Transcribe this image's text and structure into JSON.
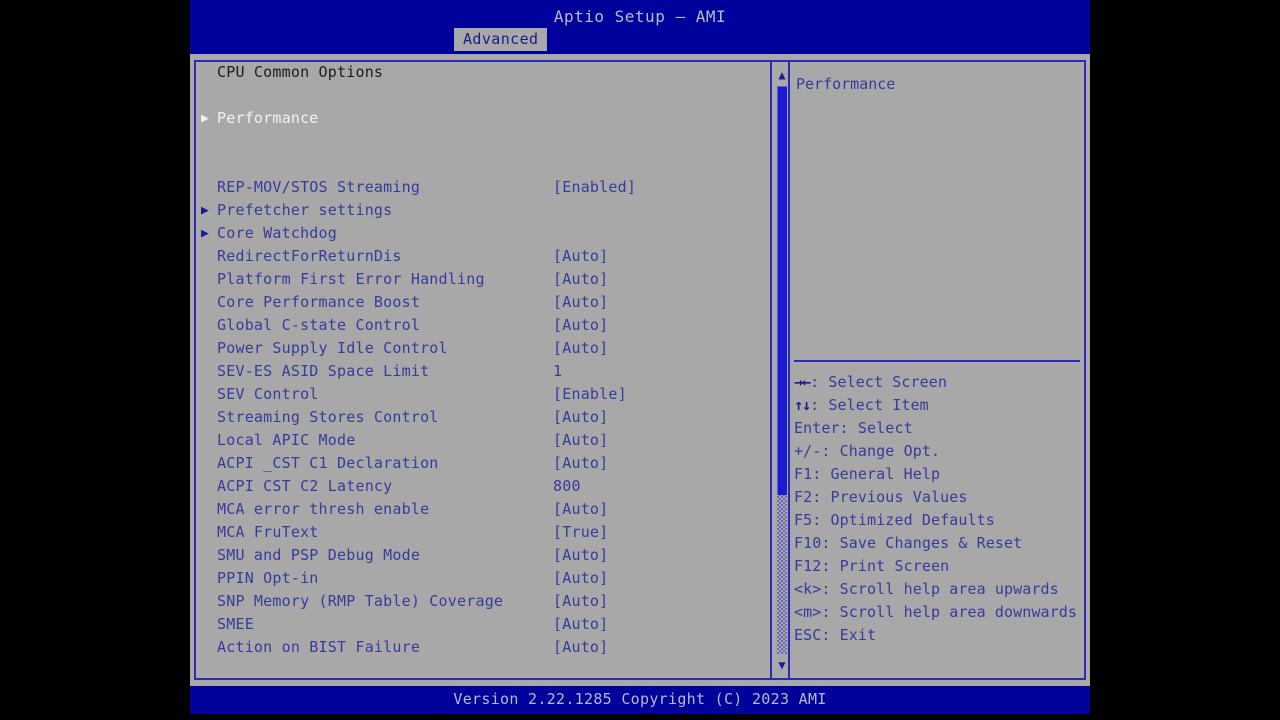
{
  "colors": {
    "screen_bg": "#000000",
    "window_bg": "#a8a8a8",
    "title_bar": "#00009b",
    "border": "#2a2ab5",
    "text": "#3a3a9c",
    "text_selected": "#f2f2f2",
    "heading": "#1c1c1c",
    "title_text": "#b9b9cf",
    "scrollbar_thumb": "#1a1ad0"
  },
  "header": {
    "title": "Aptio Setup – AMI",
    "tabs": [
      {
        "label": "Advanced",
        "active": true
      }
    ]
  },
  "options": {
    "heading": "CPU Common Options",
    "rows": [
      {
        "kind": "heading",
        "label": "CPU Common Options",
        "value": "",
        "arrow": false,
        "selected": false
      },
      {
        "kind": "spacer",
        "label": "",
        "value": "",
        "arrow": false,
        "selected": false
      },
      {
        "kind": "submenu",
        "label": "Performance",
        "value": "",
        "arrow": true,
        "selected": true
      },
      {
        "kind": "spacer",
        "label": "",
        "value": "",
        "arrow": false,
        "selected": false
      },
      {
        "kind": "spacer",
        "label": "",
        "value": "",
        "arrow": false,
        "selected": false
      },
      {
        "kind": "option",
        "label": "REP-MOV/STOS Streaming",
        "value": "[Enabled]",
        "arrow": false,
        "selected": false
      },
      {
        "kind": "submenu",
        "label": "Prefetcher settings",
        "value": "",
        "arrow": true,
        "selected": false
      },
      {
        "kind": "submenu",
        "label": "Core Watchdog",
        "value": "",
        "arrow": true,
        "selected": false
      },
      {
        "kind": "option",
        "label": "RedirectForReturnDis",
        "value": "[Auto]",
        "arrow": false,
        "selected": false
      },
      {
        "kind": "option",
        "label": "Platform First Error Handling",
        "value": "[Auto]",
        "arrow": false,
        "selected": false
      },
      {
        "kind": "option",
        "label": "Core Performance Boost",
        "value": "[Auto]",
        "arrow": false,
        "selected": false
      },
      {
        "kind": "option",
        "label": "Global C-state Control",
        "value": "[Auto]",
        "arrow": false,
        "selected": false
      },
      {
        "kind": "option",
        "label": "Power Supply Idle Control",
        "value": "[Auto]",
        "arrow": false,
        "selected": false
      },
      {
        "kind": "option",
        "label": "SEV-ES ASID Space Limit",
        "value": "1",
        "arrow": false,
        "selected": false
      },
      {
        "kind": "option",
        "label": "SEV Control",
        "value": "[Enable]",
        "arrow": false,
        "selected": false
      },
      {
        "kind": "option",
        "label": "Streaming Stores Control",
        "value": "[Auto]",
        "arrow": false,
        "selected": false
      },
      {
        "kind": "option",
        "label": "Local APIC Mode",
        "value": "[Auto]",
        "arrow": false,
        "selected": false
      },
      {
        "kind": "option",
        "label": "ACPI _CST C1 Declaration",
        "value": "[Auto]",
        "arrow": false,
        "selected": false
      },
      {
        "kind": "option",
        "label": "ACPI CST C2 Latency",
        "value": "800",
        "arrow": false,
        "selected": false
      },
      {
        "kind": "option",
        "label": "MCA error thresh enable",
        "value": "[Auto]",
        "arrow": false,
        "selected": false
      },
      {
        "kind": "option",
        "label": "MCA FruText",
        "value": "[True]",
        "arrow": false,
        "selected": false
      },
      {
        "kind": "option",
        "label": "SMU and PSP Debug Mode",
        "value": "[Auto]",
        "arrow": false,
        "selected": false
      },
      {
        "kind": "option",
        "label": "PPIN Opt-in",
        "value": "[Auto]",
        "arrow": false,
        "selected": false
      },
      {
        "kind": "option",
        "label": "SNP Memory (RMP Table) Coverage",
        "value": "[Auto]",
        "arrow": false,
        "selected": false
      },
      {
        "kind": "option",
        "label": "SMEE",
        "value": "[Auto]",
        "arrow": false,
        "selected": false
      },
      {
        "kind": "option",
        "label": "Action on BIST Failure",
        "value": "[Auto]",
        "arrow": false,
        "selected": false
      }
    ],
    "arrow_glyph": "▶"
  },
  "scrollbar": {
    "up_arrow": "▲",
    "down_arrow": "▼",
    "thumb_percent": 72
  },
  "help": {
    "text": "Performance"
  },
  "key_legend": [
    {
      "glyph": "→←",
      "text": ": Select Screen"
    },
    {
      "glyph": "↑↓",
      "text": ": Select Item"
    },
    {
      "glyph": "",
      "text": "Enter: Select"
    },
    {
      "glyph": "",
      "text": "+/-: Change Opt."
    },
    {
      "glyph": "",
      "text": "F1: General Help"
    },
    {
      "glyph": "",
      "text": "F2: Previous Values"
    },
    {
      "glyph": "",
      "text": "F5: Optimized Defaults"
    },
    {
      "glyph": "",
      "text": "F10: Save Changes & Reset"
    },
    {
      "glyph": "",
      "text": "F12: Print Screen"
    },
    {
      "glyph": "",
      "text": "<k>: Scroll help area upwards"
    },
    {
      "glyph": "",
      "text": "<m>: Scroll help area downwards"
    },
    {
      "glyph": "",
      "text": "ESC: Exit"
    }
  ],
  "footer": {
    "version": "Version 2.22.1285 Copyright (C) 2023 AMI"
  }
}
